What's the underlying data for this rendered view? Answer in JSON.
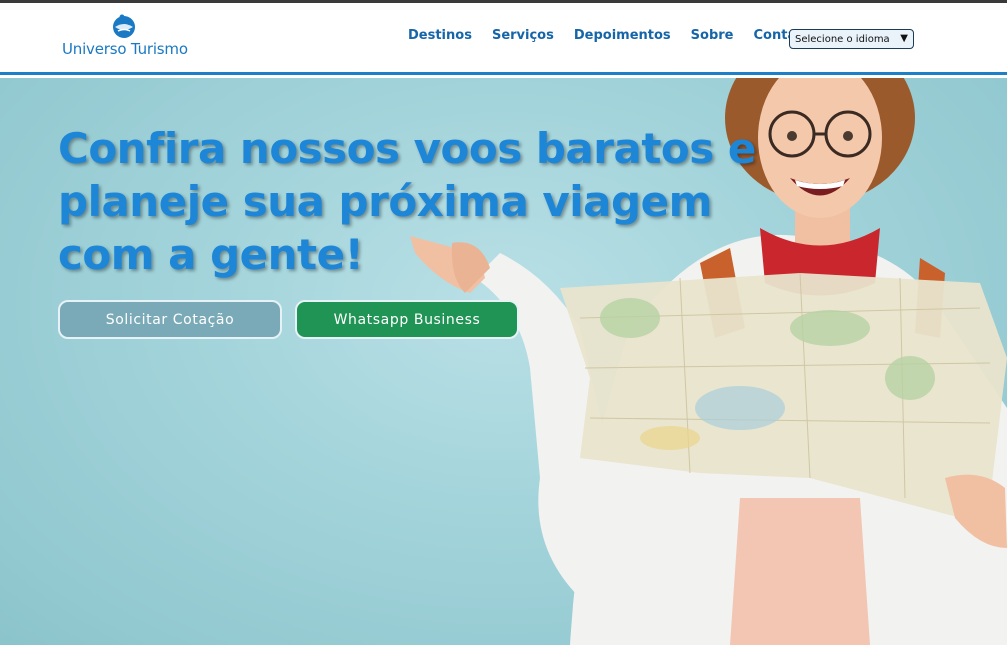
{
  "brand": {
    "name": "Universo Turismo",
    "color": "#1a79c4"
  },
  "nav": {
    "items": [
      {
        "label": "Destinos"
      },
      {
        "label": "Serviços"
      },
      {
        "label": "Depoimentos"
      },
      {
        "label": "Sobre"
      },
      {
        "label": "Contato"
      }
    ]
  },
  "language_select": {
    "selected": "Selecione o idioma"
  },
  "hero": {
    "headline": "Confira nossos voos baratos e planeje sua próxima viagem com a gente!",
    "quote_button": "Solicitar Cotação",
    "whatsapp_button": "Whatsapp Business"
  },
  "colors": {
    "accent": "#1e86d6",
    "nav_text": "#1565a8",
    "whatsapp": "#1f9455",
    "quote_button": "#7aaab8",
    "hero_background": "#a2d3da"
  }
}
